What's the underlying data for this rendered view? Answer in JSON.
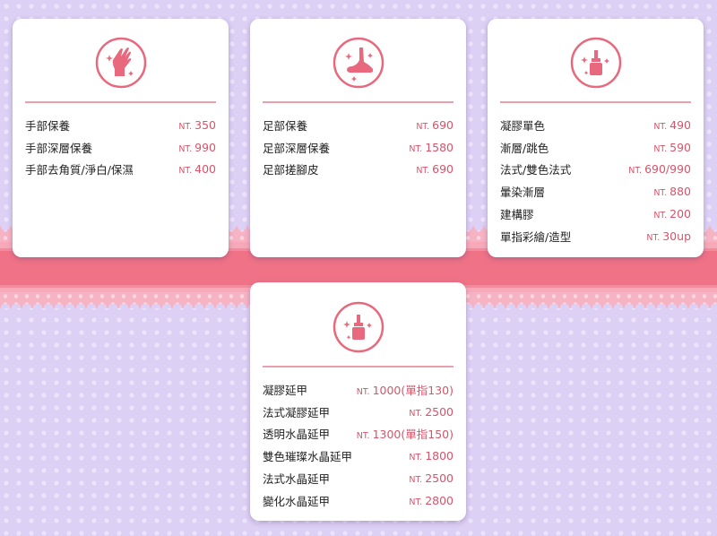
{
  "currency_label": "NT.",
  "colors": {
    "accent": "#e8687d",
    "ribbon": "#ef7287",
    "background": "#dcd0f5"
  },
  "cards": [
    {
      "icon": "hand-icon",
      "items": [
        {
          "name": "手部保養",
          "price": "350"
        },
        {
          "name": "手部深層保養",
          "price": "990"
        },
        {
          "name": "手部去角質/淨白/保濕",
          "price": "400"
        }
      ]
    },
    {
      "icon": "foot-icon",
      "items": [
        {
          "name": "足部保養",
          "price": "690"
        },
        {
          "name": "足部深層保養",
          "price": "1580"
        },
        {
          "name": "足部搓腳皮",
          "price": "690"
        }
      ]
    },
    {
      "icon": "nail-polish-icon",
      "items": [
        {
          "name": "凝膠單色",
          "price": "490"
        },
        {
          "name": "漸層/跳色",
          "price": "590"
        },
        {
          "name": "法式/雙色法式",
          "price": "690/990"
        },
        {
          "name": "暈染漸層",
          "price": "880"
        },
        {
          "name": "建構膠",
          "price": "200"
        },
        {
          "name": "單指彩繪/造型",
          "price": "30up"
        }
      ]
    },
    {
      "icon": "nail-polish-icon",
      "items": [
        {
          "name": "凝膠延甲",
          "price": "1000(單指130)"
        },
        {
          "name": "法式凝膠延甲",
          "price": "2500"
        },
        {
          "name": "透明水晶延甲",
          "price": "1300(單指150)"
        },
        {
          "name": "雙色璀璨水晶延甲",
          "price": "1800"
        },
        {
          "name": "法式水晶延甲",
          "price": "2500"
        },
        {
          "name": "變化水晶延甲",
          "price": "2800"
        }
      ]
    }
  ]
}
